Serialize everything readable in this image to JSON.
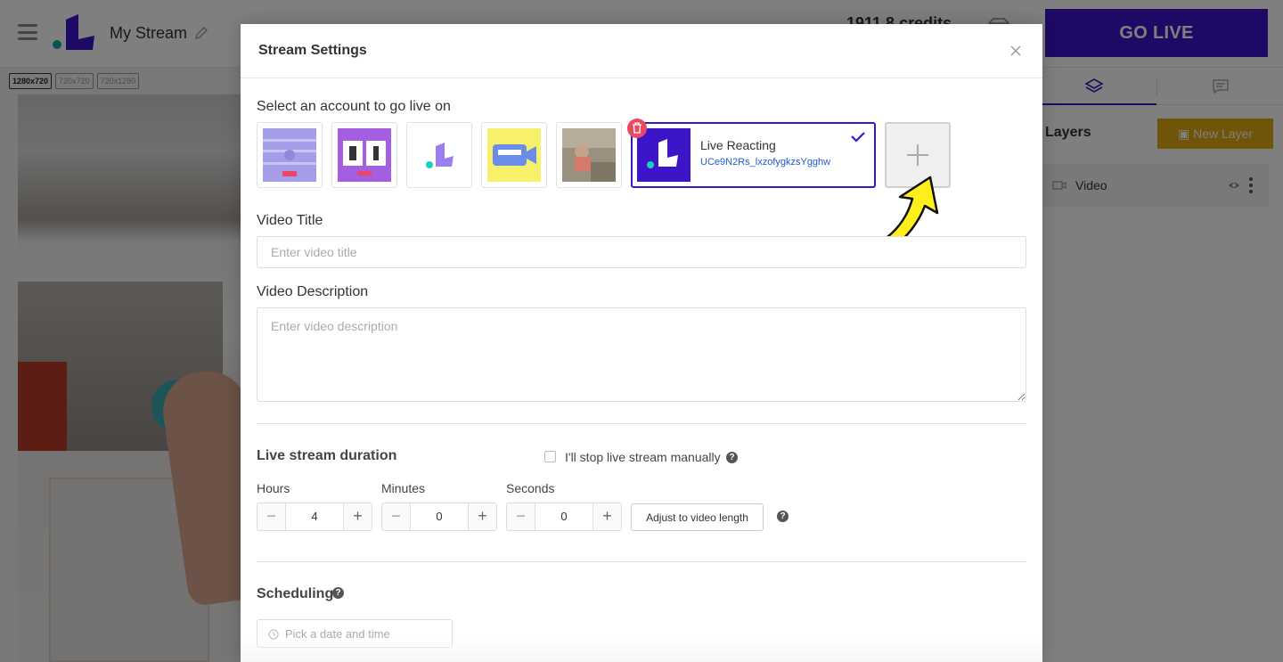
{
  "app": {
    "stream_name": "My Stream",
    "credits": "1911.8 credits",
    "go_live_label": "GO LIVE",
    "brand_color": "#3c15c8",
    "resolutions": [
      "1280x720",
      "720x720",
      "720x1280"
    ],
    "active_resolution": "1280x720",
    "icons": [
      "menu-icon",
      "logo-icon",
      "pencil-icon",
      "diamond-icon",
      "layers-icon",
      "chat-icon",
      "video-icon",
      "eye-icon",
      "more-vertical-icon"
    ]
  },
  "layers_panel": {
    "title": "Layers",
    "new_layer_label": "New Layer",
    "new_layer_color": "#e0a90f",
    "items": [
      {
        "label": "Video"
      }
    ]
  },
  "modal": {
    "title": "Stream Settings",
    "account_section_label": "Select an account to go live on",
    "selected_account": {
      "name": "Live Reacting",
      "id": "UCe9N2Rs_lxzofygkzsYgghw"
    },
    "account_thumbnails": [
      "countdown-thumbnail",
      "timer-thumbnail",
      "logo-thumbnail",
      "live-streaming-thumbnail",
      "photo-thumbnail"
    ],
    "video_title": {
      "label": "Video Title",
      "placeholder": "Enter video title",
      "value": ""
    },
    "video_description": {
      "label": "Video Description",
      "placeholder": "Enter video description",
      "value": ""
    },
    "duration": {
      "label": "Live stream duration",
      "manual_stop_label": "I'll stop live stream manually",
      "manual_stop_checked": false,
      "hours": {
        "label": "Hours",
        "value": "4"
      },
      "minutes": {
        "label": "Minutes",
        "value": "0"
      },
      "seconds": {
        "label": "Seconds",
        "value": "0"
      },
      "minus_symbol": "−",
      "plus_symbol": "+",
      "adjust_label": "Adjust to video length"
    },
    "scheduling": {
      "label": "Scheduling",
      "placeholder": "Pick a date and time"
    },
    "help_symbol": "?"
  }
}
